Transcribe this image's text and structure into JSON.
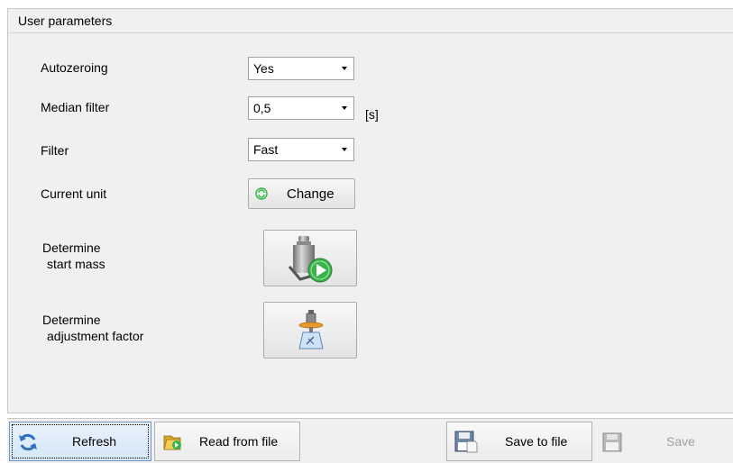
{
  "panel": {
    "title": "User parameters"
  },
  "params": {
    "autozeroing": {
      "label": "Autozeroing",
      "value": "Yes"
    },
    "median_filter": {
      "label": "Median filter",
      "value": "0,5",
      "unit": "[s]"
    },
    "filter": {
      "label": "Filter",
      "value": "Fast"
    },
    "current_unit": {
      "label": "Current unit",
      "button_label": "Change"
    },
    "start_mass": {
      "label_line1": "Determine",
      "label_line2": "start mass"
    },
    "adjustment_factor": {
      "label_line1": "Determine",
      "label_line2": "adjustment factor"
    }
  },
  "toolbar": {
    "refresh_label": "Refresh",
    "read_label": "Read from file",
    "save_file_label": "Save to file",
    "save_label": "Save"
  },
  "icons": {
    "change": "change-unit-icon",
    "start_mass": "weight-play-icon",
    "adjustment": "scale-adjust-icon",
    "refresh": "refresh-icon",
    "read": "folder-open-icon",
    "save_file": "floppy-file-icon",
    "save": "floppy-disabled-icon"
  },
  "colors": {
    "panel_bg": "#f0f0f0",
    "accent_blue": "#2f6fc4",
    "play_green": "#3ab54a"
  }
}
